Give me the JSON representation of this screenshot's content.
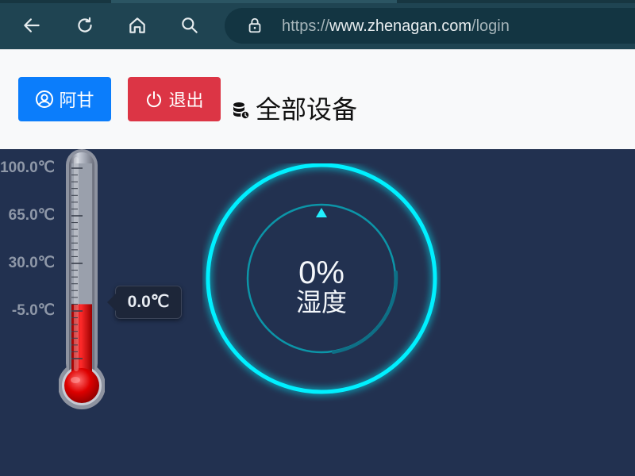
{
  "browser": {
    "url_scheme": "https://",
    "url_domain": "www.zhenagan.com",
    "url_path": "/login",
    "icons": [
      "back-icon",
      "reload-icon",
      "home-icon",
      "search-icon",
      "lock-icon"
    ]
  },
  "header": {
    "user_button_label": "阿甘",
    "logout_button_label": "退出",
    "devices_title": "全部设备",
    "user_button_color": "#0b7dfb",
    "logout_button_color": "#dc3545"
  },
  "temperature": {
    "scale_labels": [
      "100.0℃",
      "65.0℃",
      "30.0℃",
      "-5.0℃"
    ],
    "scale_min": -40,
    "scale_max": 100,
    "current_value": 0.0,
    "current_label": "0.0℃",
    "fill_color": "#d40000"
  },
  "humidity": {
    "value_text": "0%",
    "label": "湿度",
    "value": 0,
    "ring_color": "#00f0ff"
  }
}
